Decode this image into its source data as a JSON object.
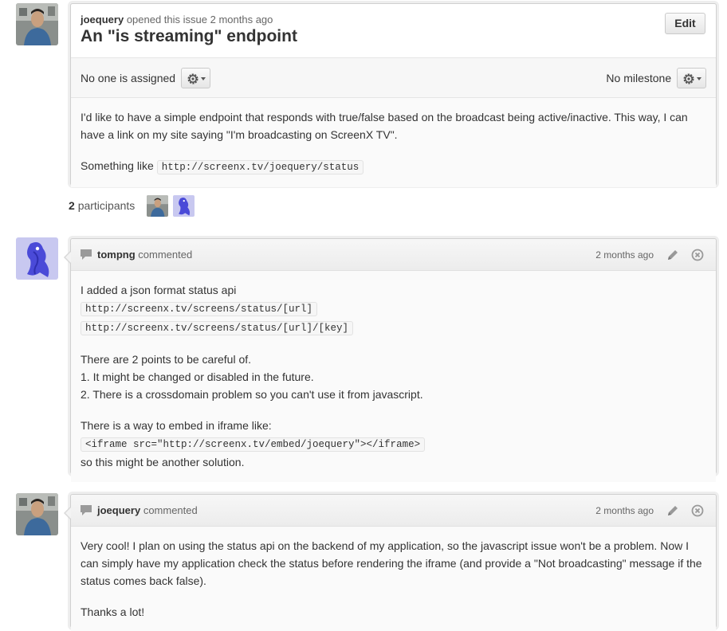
{
  "issue": {
    "author": "joequery",
    "opened_text": "opened this issue 2 months ago",
    "title": "An \"is streaming\" endpoint",
    "edit_label": "Edit",
    "assignee_text": "No one is assigned",
    "milestone_text": "No milestone",
    "body": {
      "p1": "I'd like to have a simple endpoint that responds with true/false based on the broadcast being active/inactive. This way, I can have a link on my site saying \"I'm broadcasting on ScreenX TV\".",
      "p2_prefix": "Something like",
      "p2_code": "http://screenx.tv/joequery/status"
    }
  },
  "participants": {
    "count": "2",
    "label": "participants"
  },
  "comments": [
    {
      "author": "tompng",
      "action": "commented",
      "time": "2 months ago",
      "intro": "I added a json format status api",
      "code1": "http://screenx.tv/screens/status/[url]",
      "code2": "http://screenx.tv/screens/status/[url]/[key]",
      "points_intro": "There are 2 points to be careful of.",
      "point1": "1. It might be changed or disabled in the future.",
      "point2": "2. There is a crossdomain problem so you can't use it from javascript.",
      "embed_intro": "There is a way to embed in iframe like:",
      "embed_code": "<iframe src=\"http://screenx.tv/embed/joequery\"></iframe>",
      "embed_outro": "so this might be another solution."
    },
    {
      "author": "joequery",
      "action": "commented",
      "time": "2 months ago",
      "p1": "Very cool! I plan on using the status api on the backend of my application, so the javascript issue won't be a problem. Now I can simply have my application check the status before rendering the iframe (and provide a \"Not broadcasting\" message if the status comes back false).",
      "p2": "Thanks a lot!"
    }
  ],
  "icons": {
    "gear": "gear-icon",
    "chat": "chat-bubble-icon",
    "pencil": "pencil-icon",
    "close": "close-circle-icon"
  },
  "colors": {
    "border": "#d0d0d0",
    "text": "#333333",
    "muted": "#666666",
    "avatar_blue": "#4a4ad8"
  }
}
